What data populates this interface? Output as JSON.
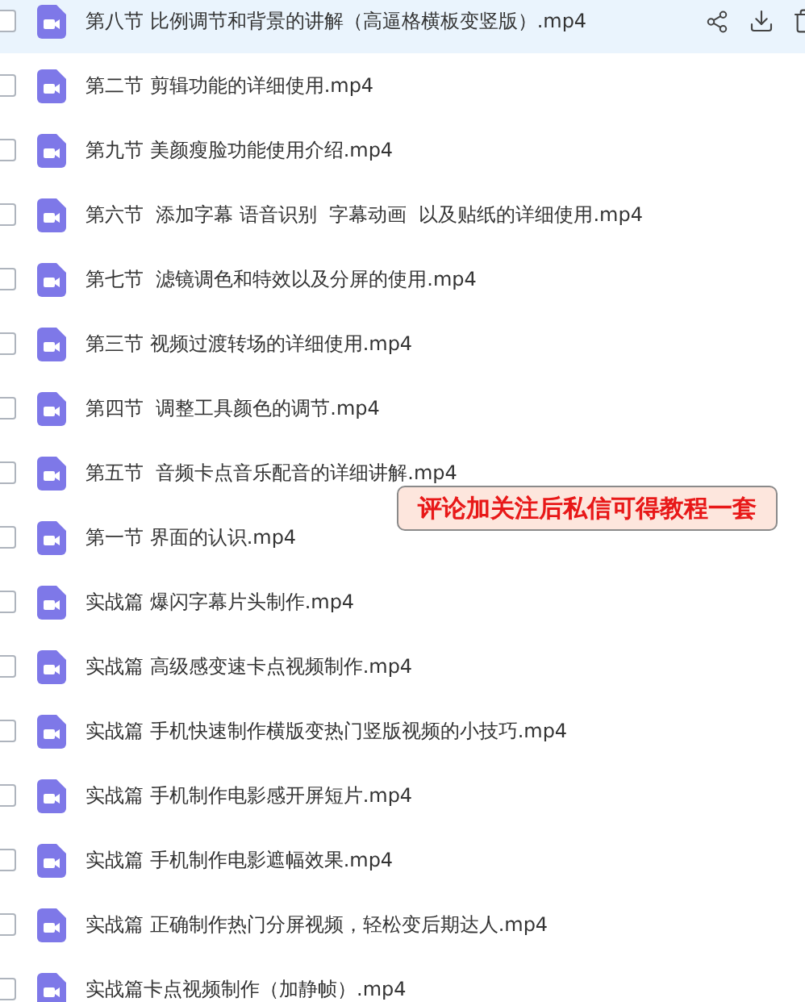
{
  "files": [
    {
      "name": "第八节 比例调节和背景的讲解（高逼格横板变竖版）.mp4",
      "checked": false,
      "highlighted": true
    },
    {
      "name": "第二节 剪辑功能的详细使用.mp4",
      "checked": false,
      "highlighted": false
    },
    {
      "name": "第九节 美颜瘦脸功能使用介绍.mp4",
      "checked": false,
      "highlighted": false
    },
    {
      "name": "第六节  添加字幕 语音识别  字幕动画  以及贴纸的详细使用.mp4",
      "checked": false,
      "highlighted": false
    },
    {
      "name": "第七节  滤镜调色和特效以及分屏的使用.mp4",
      "checked": false,
      "highlighted": false
    },
    {
      "name": "第三节 视频过渡转场的详细使用.mp4",
      "checked": false,
      "highlighted": false
    },
    {
      "name": "第四节  调整工具颜色的调节.mp4",
      "checked": false,
      "highlighted": false
    },
    {
      "name": "第五节  音频卡点音乐配音的详细讲解.mp4",
      "checked": false,
      "highlighted": false
    },
    {
      "name": "第一节 界面的认识.mp4",
      "checked": false,
      "highlighted": false
    },
    {
      "name": "实战篇 爆闪字幕片头制作.mp4",
      "checked": false,
      "highlighted": false
    },
    {
      "name": "实战篇 高级感变速卡点视频制作.mp4",
      "checked": false,
      "highlighted": false
    },
    {
      "name": "实战篇 手机快速制作横版变热门竖版视频的小技巧.mp4",
      "checked": false,
      "highlighted": false
    },
    {
      "name": "实战篇 手机制作电影感开屏短片.mp4",
      "checked": false,
      "highlighted": false
    },
    {
      "name": "实战篇 手机制作电影遮幅效果.mp4",
      "checked": false,
      "highlighted": false
    },
    {
      "name": "实战篇 正确制作热门分屏视频，轻松变后期达人.mp4",
      "checked": false,
      "highlighted": false
    },
    {
      "name": "实战篇卡点视频制作（加静帧）.mp4",
      "checked": false,
      "highlighted": false
    }
  ],
  "banner": {
    "text": "评论加关注后私信可得教程一套"
  }
}
